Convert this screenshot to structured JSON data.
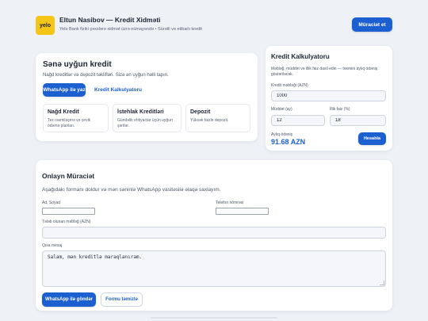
{
  "header": {
    "logo_text": "yelo",
    "title": "Eltun Nasibov — Kredit Xidməti",
    "subtitle": "Yelo Bank fiziki şəxslərə xidmət üzrə nümayəndə • Sürətli və etibarlı kredit",
    "apply_button": "Müraciət et"
  },
  "hero": {
    "title": "Sənə uyğun kredit",
    "subtitle": "Nağd kreditlər və depozit təklifləri. Sizə ən uyğun həlli tapın.",
    "whatsapp_button": "WhatsApp ilə yaz",
    "calculator_link": "Kredit Kalkulyatoru",
    "services": [
      {
        "title": "Nağd Kredit",
        "desc": "Tez rəsmiləşmə və çevik ödəmə planları."
      },
      {
        "title": "İstehlak Kreditləri",
        "desc": "Gündəlik ehtiyaclar üçün uyğun şərtlər."
      },
      {
        "title": "Depozit",
        "desc": "Yüksək faizlə depozit."
      }
    ]
  },
  "calculator": {
    "title": "Kredit Kalkulyatoru",
    "desc": "Məbləğ, müddət və illik faiz daxil edin — təxmini aylıq ödəniş göstəriləcək.",
    "amount_label": "Kredit məbləği (AZN)",
    "amount_value": "1000",
    "term_label": "Müddət (ay)",
    "term_value": "12",
    "rate_label": "İllik faiz (%)",
    "rate_value": "18",
    "monthly_label": "Aylıq ödəniş",
    "monthly_value": "91.68 AZN",
    "calc_button": "Hesabla"
  },
  "application": {
    "title": "Onlayn Müraciət",
    "desc": "Aşağıdakı formanı doldur və mən səninlə WhatsApp vasitəsilə əlaqə saxlayım.",
    "name_label": "Ad, Soyad",
    "phone_label": "Telefon nömrəsi",
    "amount_label": "Tələb olunan məbləğ (AZN)",
    "message_label": "Qısa mesaj",
    "message_value": "Salam, mən kreditlə maraqlanıram.",
    "send_button": "WhatsApp ilə göndər",
    "clear_button": "Formu təmizlə"
  },
  "colors": {
    "accent": "#1c5fd1",
    "logo_bg": "#f5c518",
    "amount": "#1c5fd1"
  }
}
